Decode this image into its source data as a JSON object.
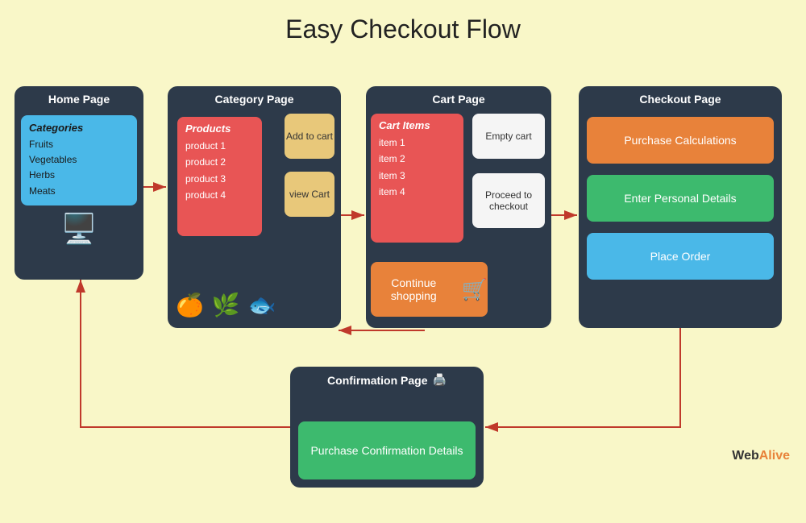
{
  "title": "Easy Checkout Flow",
  "home_card": {
    "title": "Home Page",
    "categories_title": "Categories",
    "items": [
      "Fruits",
      "Vegetables",
      "Herbs",
      "Meats"
    ]
  },
  "category_card": {
    "title": "Category Page",
    "products_title": "Products",
    "products": [
      "product 1",
      "product 2",
      "product 3",
      "product 4"
    ],
    "btn_add": "Add to cart",
    "btn_view": "view Cart",
    "emojis": [
      "🍊",
      "🌿",
      "🐟"
    ]
  },
  "cart_card": {
    "title": "Cart Page",
    "items_title": "Cart Items",
    "items": [
      "item 1",
      "item 2",
      "item 3",
      "item 4"
    ],
    "btn_empty": "Empty cart",
    "btn_proceed": "Proceed to checkout",
    "btn_continue": "Continue shopping"
  },
  "checkout_card": {
    "title": "Checkout Page",
    "btn_purchase": "Purchase Calculations",
    "btn_personal": "Enter Personal Details",
    "btn_order": "Place Order"
  },
  "confirmation_card": {
    "title": "Confirmation Page",
    "btn_details": "Purchase Confirmation Details"
  },
  "webalive": {
    "web": "Web",
    "alive": "Alive"
  }
}
